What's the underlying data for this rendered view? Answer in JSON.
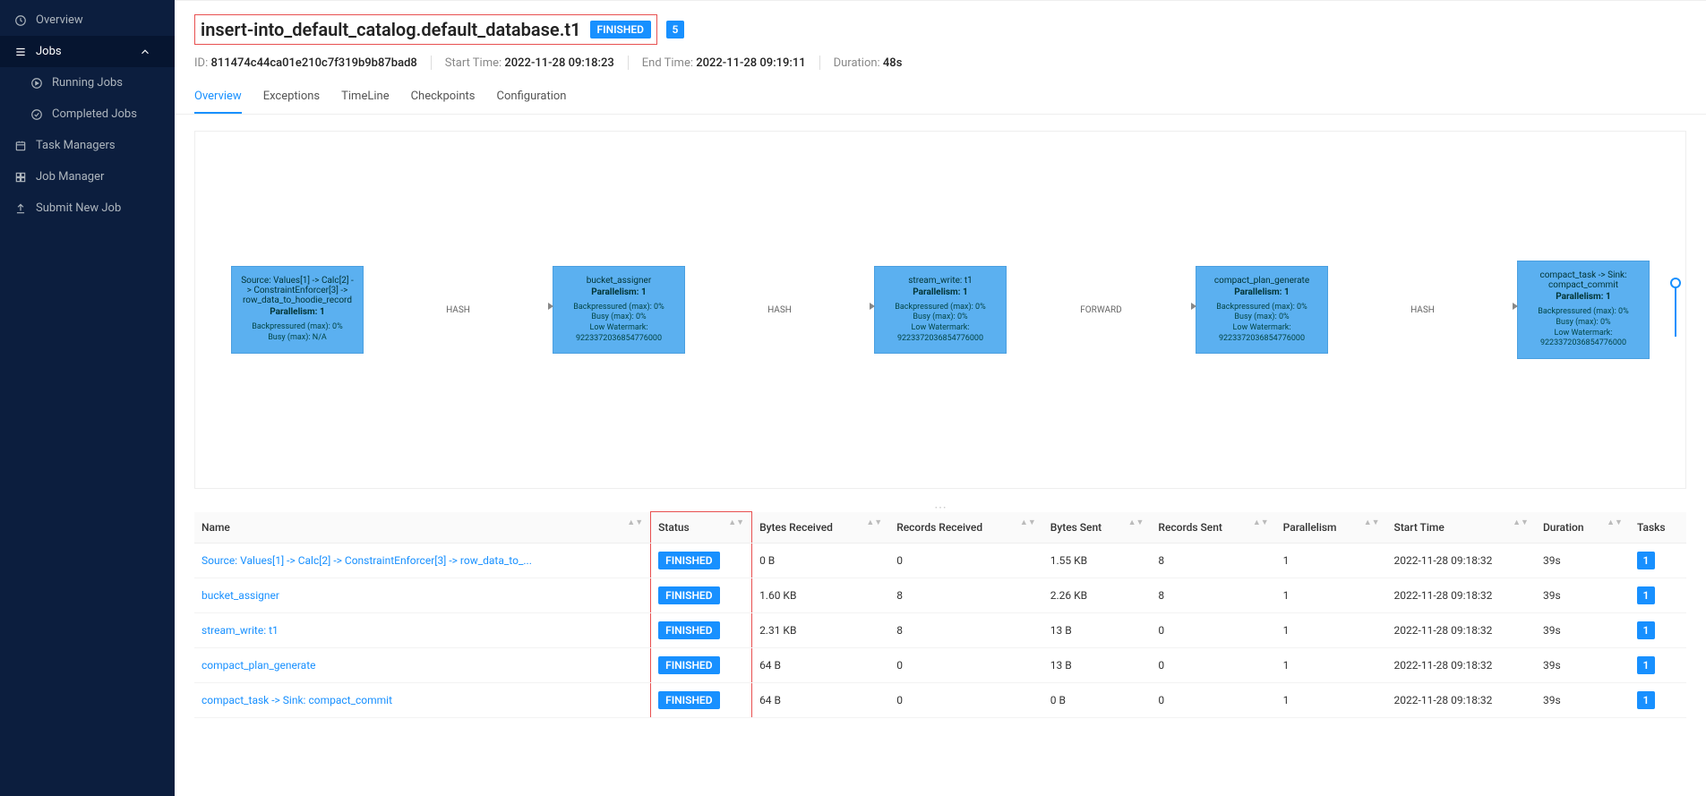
{
  "sidebar": {
    "overview": "Overview",
    "jobs": "Jobs",
    "running": "Running Jobs",
    "completed": "Completed Jobs",
    "taskmgr": "Task Managers",
    "jobmgr": "Job Manager",
    "submit": "Submit New Job"
  },
  "header": {
    "title": "insert-into_default_catalog.default_database.t1",
    "status": "FINISHED",
    "count": "5",
    "id_label": "ID:",
    "id": "811474c44ca01e210c7f319b9b87bad8",
    "start_label": "Start Time:",
    "start": "2022-11-28 09:18:23",
    "end_label": "End Time:",
    "end": "2022-11-28 09:19:11",
    "dur_label": "Duration:",
    "dur": "48s"
  },
  "tabs": {
    "overview": "Overview",
    "exceptions": "Exceptions",
    "timeline": "TimeLine",
    "checkpoints": "Checkpoints",
    "configuration": "Configuration"
  },
  "graph": {
    "nodes": [
      {
        "title": "Source: Values[1] -> Calc[2] -> ConstraintEnforcer[3] -> row_data_to_hoodie_record",
        "par": "Parallelism: 1",
        "m1": "Backpressured (max): 0%",
        "m2": "Busy (max): N/A",
        "m3": ""
      },
      {
        "title": "bucket_assigner",
        "par": "Parallelism: 1",
        "m1": "Backpressured (max): 0%",
        "m2": "Busy (max): 0%",
        "m3": "Low Watermark: 9223372036854776000"
      },
      {
        "title": "stream_write: t1",
        "par": "Parallelism: 1",
        "m1": "Backpressured (max): 0%",
        "m2": "Busy (max): 0%",
        "m3": "Low Watermark: 9223372036854776000"
      },
      {
        "title": "compact_plan_generate",
        "par": "Parallelism: 1",
        "m1": "Backpressured (max): 0%",
        "m2": "Busy (max): 0%",
        "m3": "Low Watermark: 9223372036854776000"
      },
      {
        "title": "compact_task -> Sink: compact_commit",
        "par": "Parallelism: 1",
        "m1": "Backpressured (max): 0%",
        "m2": "Busy (max): 0%",
        "m3": "Low Watermark: 9223372036854776000"
      }
    ],
    "edges": [
      "HASH",
      "HASH",
      "FORWARD",
      "HASH"
    ]
  },
  "table": {
    "cols": {
      "name": "Name",
      "status": "Status",
      "brec": "Bytes Received",
      "rrec": "Records Received",
      "bsent": "Bytes Sent",
      "rsent": "Records Sent",
      "par": "Parallelism",
      "start": "Start Time",
      "dur": "Duration",
      "tasks": "Tasks"
    },
    "rows": [
      {
        "name": "Source: Values[1] -> Calc[2] -> ConstraintEnforcer[3] -> row_data_to_...",
        "status": "FINISHED",
        "brec": "0 B",
        "rrec": "0",
        "bsent": "1.55 KB",
        "rsent": "8",
        "par": "1",
        "start": "2022-11-28 09:18:32",
        "dur": "39s",
        "tasks": "1"
      },
      {
        "name": "bucket_assigner",
        "status": "FINISHED",
        "brec": "1.60 KB",
        "rrec": "8",
        "bsent": "2.26 KB",
        "rsent": "8",
        "par": "1",
        "start": "2022-11-28 09:18:32",
        "dur": "39s",
        "tasks": "1"
      },
      {
        "name": "stream_write: t1",
        "status": "FINISHED",
        "brec": "2.31 KB",
        "rrec": "8",
        "bsent": "13 B",
        "rsent": "0",
        "par": "1",
        "start": "2022-11-28 09:18:32",
        "dur": "39s",
        "tasks": "1"
      },
      {
        "name": "compact_plan_generate",
        "status": "FINISHED",
        "brec": "64 B",
        "rrec": "0",
        "bsent": "13 B",
        "rsent": "0",
        "par": "1",
        "start": "2022-11-28 09:18:32",
        "dur": "39s",
        "tasks": "1"
      },
      {
        "name": "compact_task -> Sink: compact_commit",
        "status": "FINISHED",
        "brec": "64 B",
        "rrec": "0",
        "bsent": "0 B",
        "rsent": "0",
        "par": "1",
        "start": "2022-11-28 09:18:32",
        "dur": "39s",
        "tasks": "1"
      }
    ]
  }
}
